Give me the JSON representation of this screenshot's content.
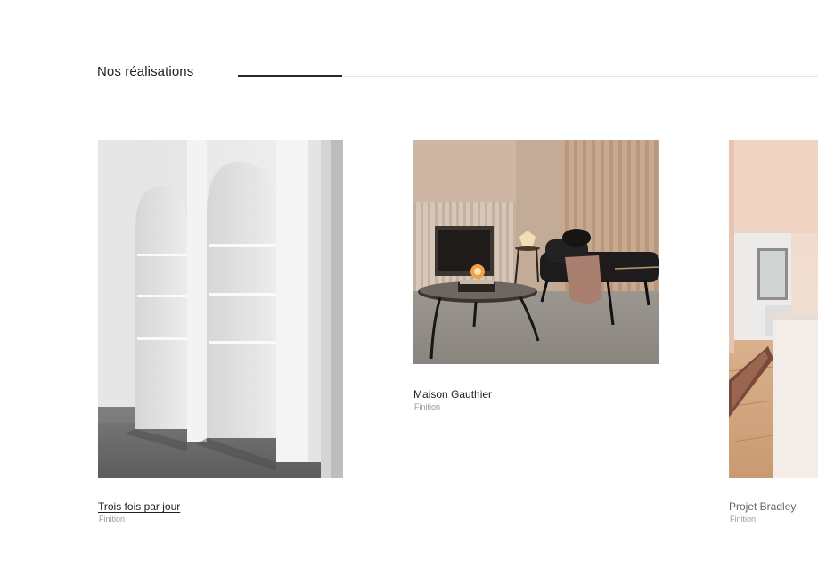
{
  "section": {
    "title": "Nos réalisations",
    "scroll_progress": 0.18
  },
  "projects": [
    {
      "title": "Trois fois par jour",
      "category": "Finition",
      "image": "white-arched-shelving-room"
    },
    {
      "title": "Maison Gauthier",
      "category": "Finition",
      "image": "living-room-fireplace-chaise"
    },
    {
      "title": "Projet Bradley",
      "category": "Finition",
      "image": "bright-room-rug-window"
    }
  ],
  "colors": {
    "text": "#1e1e1e",
    "muted": "#9a9a9a",
    "track": "#e6e6e6",
    "progress": "#1f2a2a"
  }
}
